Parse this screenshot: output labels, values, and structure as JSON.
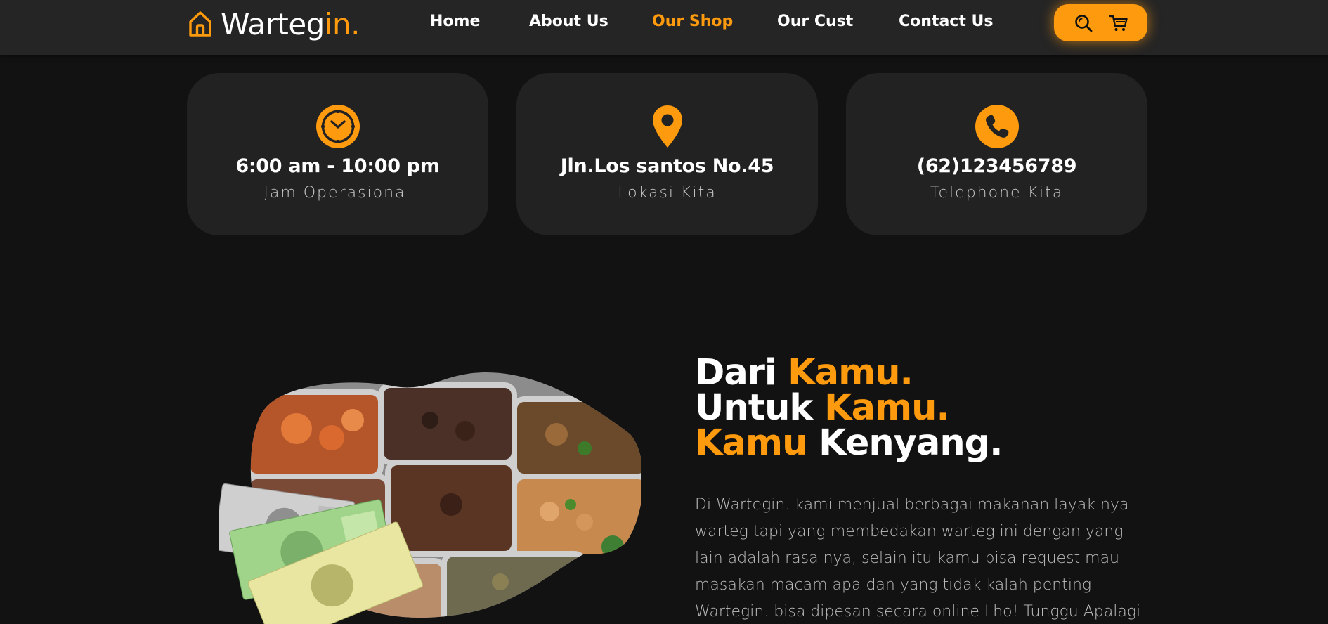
{
  "brand": {
    "name_main": "Wartegin",
    "name_accent": "in.",
    "name_prefix": "Warteg",
    "accent_color": "#fe9a0e",
    "icon": "home-icon"
  },
  "nav": {
    "items": [
      {
        "label": "Home",
        "active": false
      },
      {
        "label": "About Us",
        "active": false
      },
      {
        "label": "Our Shop",
        "active": true
      },
      {
        "label": "Our Cust",
        "active": false
      },
      {
        "label": "Contact Us",
        "active": false
      }
    ],
    "actions": [
      {
        "icon": "search-icon"
      },
      {
        "icon": "cart-icon"
      }
    ]
  },
  "info_cards": [
    {
      "icon": "clock-icon",
      "value": "6:00 am - 10:00 pm",
      "label": "Jam Operasional"
    },
    {
      "icon": "location-pin-icon",
      "value": "Jln.Los santos No.45",
      "label": "Lokasi Kita"
    },
    {
      "icon": "phone-icon",
      "value": "(62)123456789",
      "label": "Telephone Kita"
    }
  ],
  "hero": {
    "line1_white": "Dari ",
    "line1_accent": "Kamu.",
    "line2_white": "Untuk ",
    "line2_accent": "Kamu.",
    "line3_accent": "Kamu",
    "line3_white": " Kenyang.",
    "description": "Di Wartegin. kami menjual berbagai makanan layak nya warteg tapi yang membedakan warteg ini dengan yang lain adalah rasa nya, selain itu kamu bisa request mau masakan macam apa dan yang tidak kalah penting Wartegin. bisa dipesan secara online Lho! Tunggu Apalagi"
  },
  "colors": {
    "background": "#121212",
    "navbar": "#252525",
    "card": "#222222",
    "accent": "#fe9a0e"
  }
}
